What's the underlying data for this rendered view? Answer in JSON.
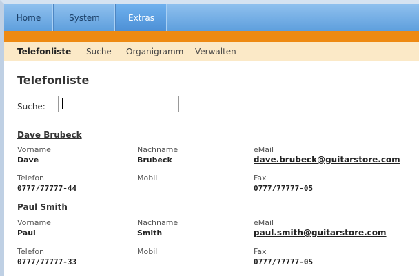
{
  "top_nav": {
    "tabs": [
      {
        "label": "Home",
        "active": false
      },
      {
        "label": "System",
        "active": false
      },
      {
        "label": "Extras",
        "active": true
      }
    ]
  },
  "sub_nav": {
    "items": [
      {
        "label": "Telefonliste",
        "active": true
      },
      {
        "label": "Suche",
        "active": false
      },
      {
        "label": "Organigramm",
        "active": false
      },
      {
        "label": "Verwalten",
        "active": false
      }
    ]
  },
  "main": {
    "title": "Telefonliste",
    "search": {
      "label": "Suche:",
      "value": "",
      "placeholder": ""
    },
    "labels": {
      "first_name": "Vorname",
      "last_name": "Nachname",
      "email": "eMail",
      "phone": "Telefon",
      "mobile": "Mobil",
      "fax": "Fax"
    },
    "contacts": [
      {
        "name": "Dave Brubeck",
        "first_name": "Dave",
        "last_name": "Brubeck",
        "email": "dave.brubeck@guitarstore.com",
        "phone": "0777/77777-44",
        "mobile": "",
        "fax": "0777/77777-05"
      },
      {
        "name": "Paul Smith",
        "first_name": "Paul",
        "last_name": "Smith",
        "email": "paul.smith@guitarstore.com",
        "phone": "0777/77777-33",
        "mobile": "",
        "fax": "0777/77777-05"
      }
    ]
  },
  "colors": {
    "nav_blue": "#6aa7e3",
    "nav_active": "#4d90d6",
    "orange_bar": "#ee8a12",
    "subnav_bg": "#fbe9c7"
  }
}
